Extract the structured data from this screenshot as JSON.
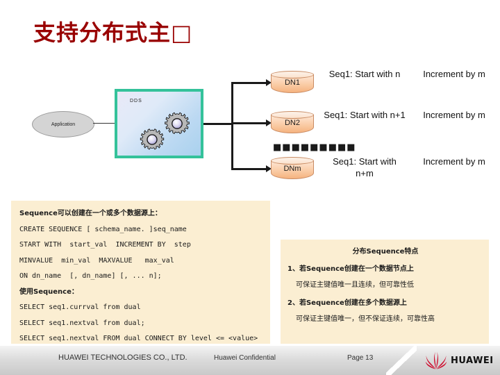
{
  "slide": {
    "title": "支持分布式主□"
  },
  "diagram": {
    "application_label": "Application",
    "dds_label": "DDS",
    "ellipsis": "■■■■■■■■■",
    "nodes": [
      {
        "name": "DN1",
        "seq_start": "Seq1: Start with n",
        "seq_increment": "Increment by m"
      },
      {
        "name": "DN2",
        "seq_start": "Seq1: Start with n+1",
        "seq_increment": "Increment by m"
      },
      {
        "name": "DNm",
        "seq_start": "Seq1: Start with n+m",
        "seq_increment": "Increment by m"
      }
    ]
  },
  "sql_panel": {
    "lines": [
      {
        "text": "Sequence可以创建在一个或多个数据源上：",
        "bold_cn": true
      },
      {
        "text": "CREATE SEQUENCE [ schema_name. ]seq_name",
        "bold_cn": false
      },
      {
        "text": "START WITH  start_val  INCREMENT BY  step",
        "bold_cn": false
      },
      {
        "text": "MINVALUE  min_val  MAXVALUE   max_val",
        "bold_cn": false
      },
      {
        "text": "ON dn_name  [, dn_name] [, ... n];",
        "bold_cn": false
      },
      {
        "text": "使用Sequence：",
        "bold_cn": true
      },
      {
        "text": "SELECT seq1.currval from dual",
        "bold_cn": false
      },
      {
        "text": "SELECT seq1.nextval from dual;",
        "bold_cn": false
      },
      {
        "text": "SELECT seq1.nextval FROM dual CONNECT BY level <= <value>",
        "bold_cn": false
      }
    ]
  },
  "feature_panel": {
    "title": "分布Sequence特点",
    "items": [
      {
        "head": "1、若Sequence创建在一个数据节点上",
        "body": "可保证主键值唯一且连续，但可靠性低"
      },
      {
        "head": "2、若Sequence创建在多个数据源上",
        "body": "可保证主键值唯一，但不保证连续，可靠性高"
      }
    ]
  },
  "footer": {
    "company": "HUAWEI TECHNOLOGIES CO., LTD.",
    "confidential": "Huawei Confidential",
    "page": "Page 13",
    "wordmark": "HUAWEI"
  },
  "colors": {
    "title_red": "#990000",
    "panel_bg": "#fbeed2",
    "dds_border": "#34c29a",
    "db_fill": "#f5b37f",
    "brand_red": "#cf0a2c"
  }
}
